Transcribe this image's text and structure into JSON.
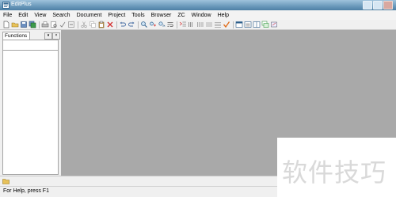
{
  "window": {
    "title": "EditPlus"
  },
  "menu": {
    "items": [
      {
        "label": "File"
      },
      {
        "label": "Edit"
      },
      {
        "label": "View"
      },
      {
        "label": "Search"
      },
      {
        "label": "Document"
      },
      {
        "label": "Project"
      },
      {
        "label": "Tools"
      },
      {
        "label": "Browser"
      },
      {
        "label": "ZC"
      },
      {
        "label": "Window"
      },
      {
        "label": "Help"
      }
    ]
  },
  "toolbar": {
    "icons": [
      "new-file-icon",
      "open-folder-icon",
      "save-icon",
      "save-all-icon",
      "print-icon",
      "print-preview-icon",
      "spell-check-icon",
      "cut-icon",
      "copy-icon",
      "paste-icon",
      "delete-icon",
      "undo-icon",
      "redo-icon",
      "find-icon",
      "replace-icon",
      "find-next-icon",
      "goto-icon",
      "word-wrap-icon",
      "indent-icon",
      "outdent-icon",
      "align-icon",
      "column-icon",
      "checkmark-icon",
      "window-icon",
      "window-list-icon",
      "tile-icon",
      "cascade-icon",
      "tools-icon"
    ]
  },
  "left_panel": {
    "tab_label": "Functions"
  },
  "status": {
    "text": "For Help, press F1"
  },
  "watermark": {
    "text": "软件技巧"
  },
  "colors": {
    "workspace": "#a9a9a9",
    "title_bar": "#6f9dbe",
    "accent_red": "#d32f2f"
  }
}
